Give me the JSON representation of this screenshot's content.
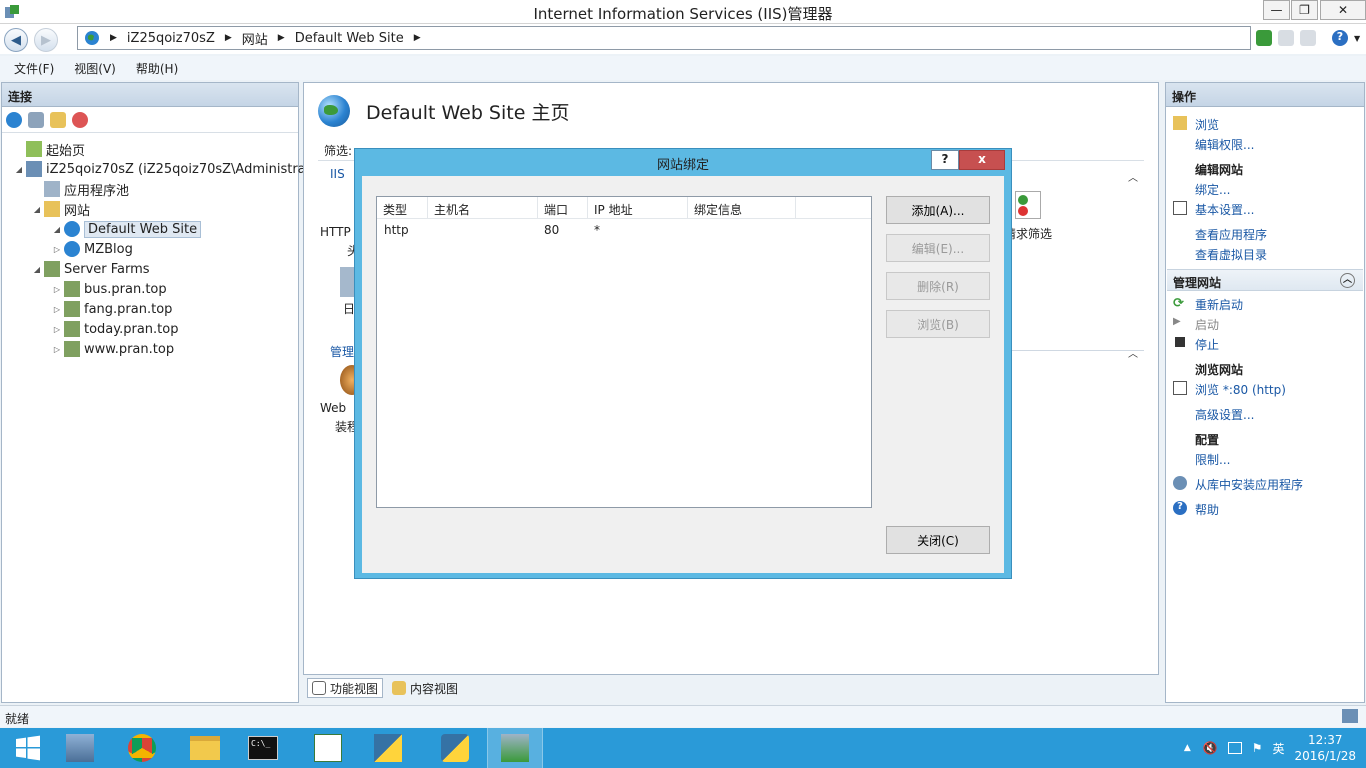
{
  "window": {
    "title": "Internet Information Services (IIS)管理器",
    "min_glyph": "—",
    "max_glyph": "❐",
    "close_glyph": "✕"
  },
  "address": {
    "back_glyph": "◀",
    "forward_glyph": "▶",
    "crumbs": [
      "iZ25qoiz70sZ",
      "网站",
      "Default Web Site"
    ],
    "help_glyph": "?"
  },
  "menu": [
    "文件(F)",
    "视图(V)",
    "帮助(H)"
  ],
  "connections": {
    "header": "连接",
    "tree": [
      {
        "label": "起始页",
        "indent": 0
      },
      {
        "label": "iZ25qoiz70sZ (iZ25qoiz70sZ\\Administrator)",
        "indent": 0
      },
      {
        "label": "应用程序池",
        "indent": 1
      },
      {
        "label": "网站",
        "indent": 1
      },
      {
        "label": "Default Web Site",
        "indent": 2
      },
      {
        "label": "MZBlog",
        "indent": 2
      },
      {
        "label": "Server Farms",
        "indent": 1
      },
      {
        "label": "bus.pran.top",
        "indent": 2
      },
      {
        "label": "fang.pran.top",
        "indent": 2
      },
      {
        "label": "today.pran.top",
        "indent": 2
      },
      {
        "label": "www.pran.top",
        "indent": 2
      }
    ]
  },
  "center": {
    "title": "Default Web Site 主页",
    "filter_label": "筛选:",
    "section_iis": "IIS",
    "section_manage": "管理",
    "feature_http": "HTTP",
    "feature_frag1": "头",
    "feature_log": "日",
    "feature_request": "请求筛选",
    "feature_web": "Web",
    "feature_web2": "装程",
    "tabs": [
      "功能视图",
      "内容视图"
    ]
  },
  "actions": {
    "header": "操作",
    "items": [
      {
        "label": "浏览",
        "type": "link"
      },
      {
        "label": "编辑权限...",
        "type": "link"
      },
      {
        "label": "编辑网站",
        "type": "head"
      },
      {
        "label": "绑定...",
        "type": "link"
      },
      {
        "label": "基本设置...",
        "type": "link"
      },
      {
        "label": "查看应用程序",
        "type": "link"
      },
      {
        "label": "查看虚拟目录",
        "type": "link"
      }
    ],
    "manage_section": "管理网站",
    "manage_items": [
      {
        "label": "重新启动",
        "type": "link"
      },
      {
        "label": "启动",
        "type": "disabled"
      },
      {
        "label": "停止",
        "type": "link"
      },
      {
        "label": "浏览网站",
        "type": "head"
      },
      {
        "label": "浏览 *:80 (http)",
        "type": "link"
      },
      {
        "label": "高级设置...",
        "type": "link"
      },
      {
        "label": "配置",
        "type": "head"
      },
      {
        "label": "限制...",
        "type": "link"
      },
      {
        "label": "从库中安装应用程序",
        "type": "link"
      },
      {
        "label": "帮助",
        "type": "link"
      }
    ]
  },
  "status": "就绪",
  "dialog": {
    "title": "网站绑定",
    "help": "?",
    "close": "x",
    "columns": [
      "类型",
      "主机名",
      "端口",
      "IP 地址",
      "绑定信息"
    ],
    "rows": [
      {
        "type": "http",
        "host": "",
        "port": "80",
        "ip": "*",
        "info": ""
      }
    ],
    "buttons": {
      "add": "添加(A)...",
      "edit": "编辑(E)...",
      "remove": "删除(R)",
      "browse": "浏览(B)",
      "close": "关闭(C)"
    }
  },
  "taskbar": {
    "time": "12:37",
    "date": "2016/1/28",
    "ime": "英"
  },
  "colors": {
    "taskbar": "#2a9ad8",
    "dialog_frame": "#5cb9e3",
    "link": "#1a58a5",
    "close_red": "#c75050"
  }
}
